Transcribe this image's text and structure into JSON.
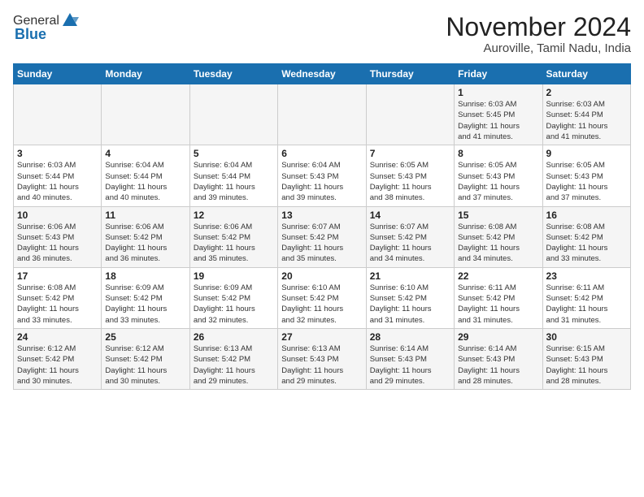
{
  "logo": {
    "general": "General",
    "blue": "Blue"
  },
  "header": {
    "month": "November 2024",
    "location": "Auroville, Tamil Nadu, India"
  },
  "weekdays": [
    "Sunday",
    "Monday",
    "Tuesday",
    "Wednesday",
    "Thursday",
    "Friday",
    "Saturday"
  ],
  "weeks": [
    [
      {
        "day": "",
        "info": ""
      },
      {
        "day": "",
        "info": ""
      },
      {
        "day": "",
        "info": ""
      },
      {
        "day": "",
        "info": ""
      },
      {
        "day": "",
        "info": ""
      },
      {
        "day": "1",
        "info": "Sunrise: 6:03 AM\nSunset: 5:45 PM\nDaylight: 11 hours\nand 41 minutes."
      },
      {
        "day": "2",
        "info": "Sunrise: 6:03 AM\nSunset: 5:44 PM\nDaylight: 11 hours\nand 41 minutes."
      }
    ],
    [
      {
        "day": "3",
        "info": "Sunrise: 6:03 AM\nSunset: 5:44 PM\nDaylight: 11 hours\nand 40 minutes."
      },
      {
        "day": "4",
        "info": "Sunrise: 6:04 AM\nSunset: 5:44 PM\nDaylight: 11 hours\nand 40 minutes."
      },
      {
        "day": "5",
        "info": "Sunrise: 6:04 AM\nSunset: 5:44 PM\nDaylight: 11 hours\nand 39 minutes."
      },
      {
        "day": "6",
        "info": "Sunrise: 6:04 AM\nSunset: 5:43 PM\nDaylight: 11 hours\nand 39 minutes."
      },
      {
        "day": "7",
        "info": "Sunrise: 6:05 AM\nSunset: 5:43 PM\nDaylight: 11 hours\nand 38 minutes."
      },
      {
        "day": "8",
        "info": "Sunrise: 6:05 AM\nSunset: 5:43 PM\nDaylight: 11 hours\nand 37 minutes."
      },
      {
        "day": "9",
        "info": "Sunrise: 6:05 AM\nSunset: 5:43 PM\nDaylight: 11 hours\nand 37 minutes."
      }
    ],
    [
      {
        "day": "10",
        "info": "Sunrise: 6:06 AM\nSunset: 5:43 PM\nDaylight: 11 hours\nand 36 minutes."
      },
      {
        "day": "11",
        "info": "Sunrise: 6:06 AM\nSunset: 5:42 PM\nDaylight: 11 hours\nand 36 minutes."
      },
      {
        "day": "12",
        "info": "Sunrise: 6:06 AM\nSunset: 5:42 PM\nDaylight: 11 hours\nand 35 minutes."
      },
      {
        "day": "13",
        "info": "Sunrise: 6:07 AM\nSunset: 5:42 PM\nDaylight: 11 hours\nand 35 minutes."
      },
      {
        "day": "14",
        "info": "Sunrise: 6:07 AM\nSunset: 5:42 PM\nDaylight: 11 hours\nand 34 minutes."
      },
      {
        "day": "15",
        "info": "Sunrise: 6:08 AM\nSunset: 5:42 PM\nDaylight: 11 hours\nand 34 minutes."
      },
      {
        "day": "16",
        "info": "Sunrise: 6:08 AM\nSunset: 5:42 PM\nDaylight: 11 hours\nand 33 minutes."
      }
    ],
    [
      {
        "day": "17",
        "info": "Sunrise: 6:08 AM\nSunset: 5:42 PM\nDaylight: 11 hours\nand 33 minutes."
      },
      {
        "day": "18",
        "info": "Sunrise: 6:09 AM\nSunset: 5:42 PM\nDaylight: 11 hours\nand 33 minutes."
      },
      {
        "day": "19",
        "info": "Sunrise: 6:09 AM\nSunset: 5:42 PM\nDaylight: 11 hours\nand 32 minutes."
      },
      {
        "day": "20",
        "info": "Sunrise: 6:10 AM\nSunset: 5:42 PM\nDaylight: 11 hours\nand 32 minutes."
      },
      {
        "day": "21",
        "info": "Sunrise: 6:10 AM\nSunset: 5:42 PM\nDaylight: 11 hours\nand 31 minutes."
      },
      {
        "day": "22",
        "info": "Sunrise: 6:11 AM\nSunset: 5:42 PM\nDaylight: 11 hours\nand 31 minutes."
      },
      {
        "day": "23",
        "info": "Sunrise: 6:11 AM\nSunset: 5:42 PM\nDaylight: 11 hours\nand 31 minutes."
      }
    ],
    [
      {
        "day": "24",
        "info": "Sunrise: 6:12 AM\nSunset: 5:42 PM\nDaylight: 11 hours\nand 30 minutes."
      },
      {
        "day": "25",
        "info": "Sunrise: 6:12 AM\nSunset: 5:42 PM\nDaylight: 11 hours\nand 30 minutes."
      },
      {
        "day": "26",
        "info": "Sunrise: 6:13 AM\nSunset: 5:42 PM\nDaylight: 11 hours\nand 29 minutes."
      },
      {
        "day": "27",
        "info": "Sunrise: 6:13 AM\nSunset: 5:43 PM\nDaylight: 11 hours\nand 29 minutes."
      },
      {
        "day": "28",
        "info": "Sunrise: 6:14 AM\nSunset: 5:43 PM\nDaylight: 11 hours\nand 29 minutes."
      },
      {
        "day": "29",
        "info": "Sunrise: 6:14 AM\nSunset: 5:43 PM\nDaylight: 11 hours\nand 28 minutes."
      },
      {
        "day": "30",
        "info": "Sunrise: 6:15 AM\nSunset: 5:43 PM\nDaylight: 11 hours\nand 28 minutes."
      }
    ]
  ]
}
